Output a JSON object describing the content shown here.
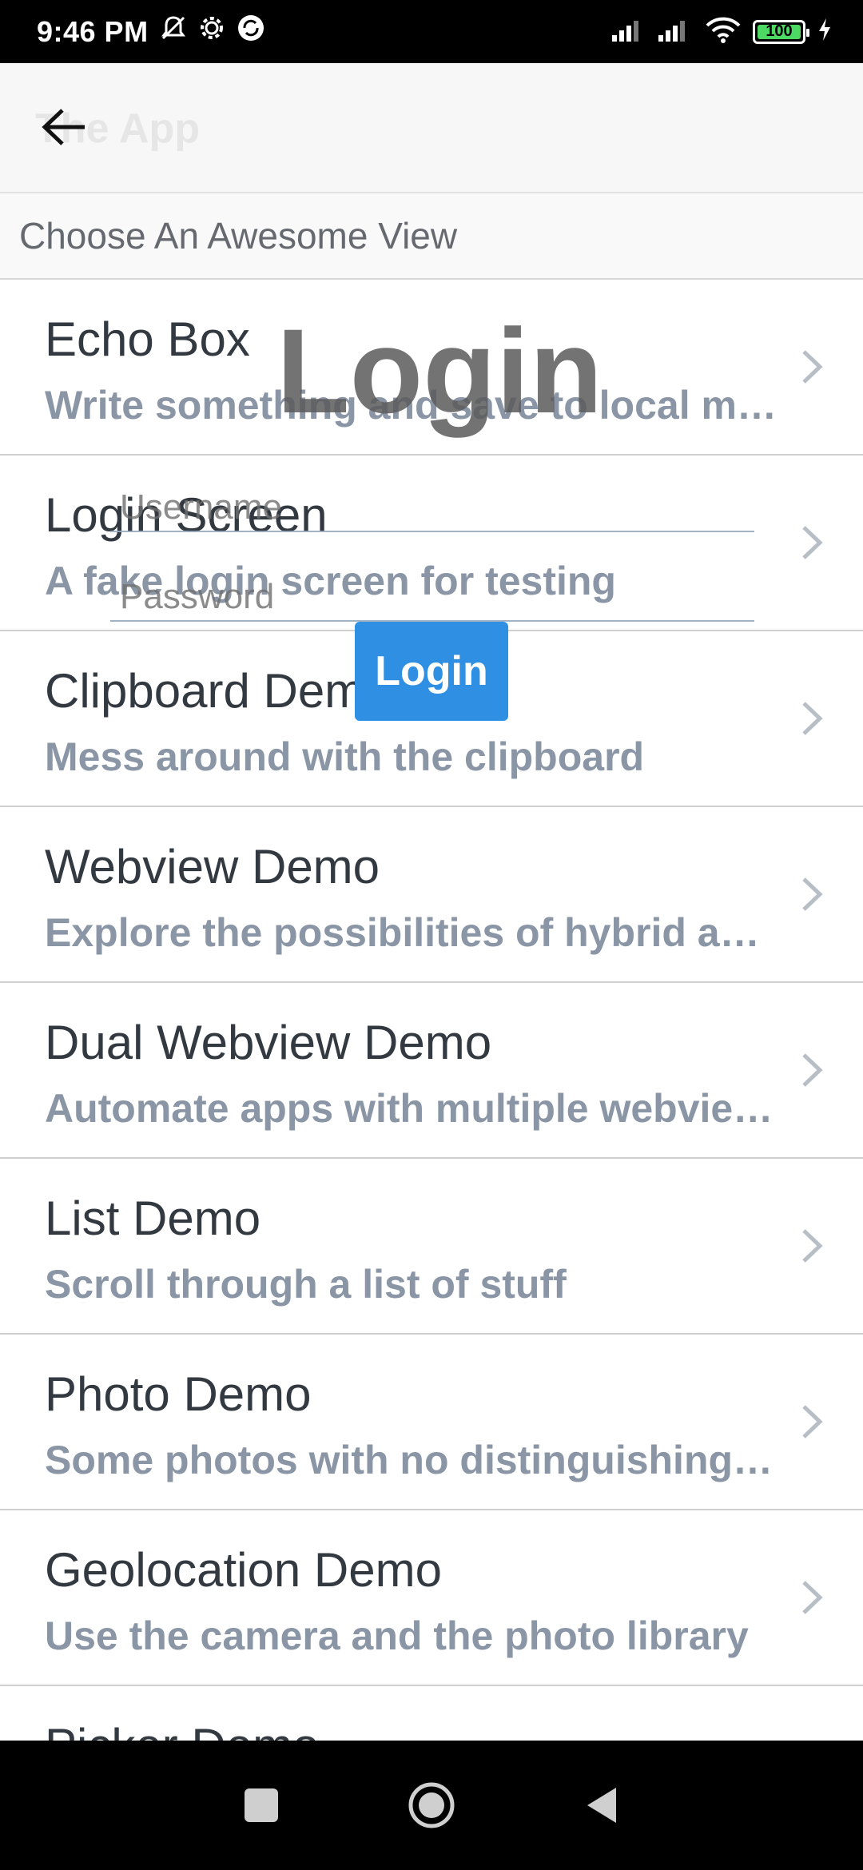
{
  "status_bar": {
    "time": "9:46 PM",
    "battery": "100",
    "icons": [
      "mute-icon",
      "settings-icon",
      "sync-icon",
      "signal-icon",
      "signal-icon-2",
      "wifi-icon",
      "battery-icon",
      "charging-icon"
    ]
  },
  "header": {
    "title": "The App",
    "back_icon": "arrow-left-icon"
  },
  "section": {
    "title": "Choose An Awesome View"
  },
  "list": {
    "items": [
      {
        "title": "Echo Box",
        "subtitle": "Write something and save to local memory"
      },
      {
        "title": "Login Screen",
        "subtitle": "A fake login screen for testing"
      },
      {
        "title": "Clipboard Demo",
        "subtitle": "Mess around with the clipboard"
      },
      {
        "title": "Webview Demo",
        "subtitle": "Explore the possibilities of hybrid apps"
      },
      {
        "title": "Dual Webview Demo",
        "subtitle": "Automate apps with multiple webviews"
      },
      {
        "title": "List Demo",
        "subtitle": "Scroll through a list of stuff"
      },
      {
        "title": "Photo Demo",
        "subtitle": "Some photos with no distinguishing features"
      },
      {
        "title": "Geolocation Demo",
        "subtitle": "Use the camera and the photo library"
      },
      {
        "title": "Picker Demo",
        "subtitle": ""
      }
    ]
  },
  "overlay": {
    "title": "Login",
    "username_placeholder": "Username",
    "password_placeholder": "Password",
    "login_button": "Login"
  },
  "nav": {
    "icons": [
      "recents-icon",
      "home-icon",
      "back-icon"
    ]
  },
  "colors": {
    "accent": "#2f8fe2",
    "title_text": "#333940",
    "subtitle_text": "#8a96a6"
  }
}
